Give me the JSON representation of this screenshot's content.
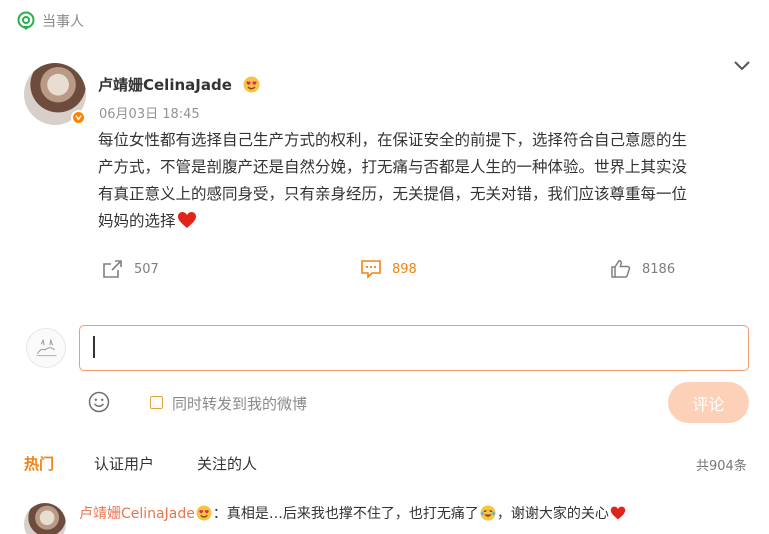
{
  "topic": {
    "label": "当事人",
    "icon": "location-pin-icon"
  },
  "post": {
    "author": "卢靖姗CelinaJade",
    "author_badge_icon": "verified-badge-icon",
    "author_emoji_icon": "heart-eyes-emoji-icon",
    "time": "06月03日 18:45",
    "lines": [
      "每位女性都有选择自己生产方式的权利，在保证安全的前提下，选择符合自己意愿的生",
      "产方式，不管是剖腹产还是自然分娩，打无痛与否都是人生的一种体验。世界上其实没",
      "有真正意义上的感同身受，只有亲身经历，无关提倡，无关对错，我们应该尊重每一位",
      "妈妈的选择"
    ],
    "end_icon": "red-heart-icon"
  },
  "actions": {
    "repost": {
      "count": "507",
      "icon": "share-icon"
    },
    "comment": {
      "count": "898",
      "icon": "comment-icon"
    },
    "like": {
      "count": "8186",
      "icon": "thumbs-up-icon"
    }
  },
  "compose": {
    "value": "",
    "repost_label": "同时转发到我的微博",
    "submit_label": "评论"
  },
  "tabs": [
    "热门",
    "认证用户",
    "关注的人"
  ],
  "total": "共904条",
  "comment": {
    "author": "卢靖姗CelinaJade",
    "separator": "：",
    "text1": "真相是…后来我也撑不住了，也打无痛了",
    "text2": "，谢谢大家的关心"
  },
  "colors": {
    "accent": "#f08314",
    "link": "#eb7350",
    "submit_bg": "#fdd1b8",
    "input_border": "#f39b6c"
  }
}
